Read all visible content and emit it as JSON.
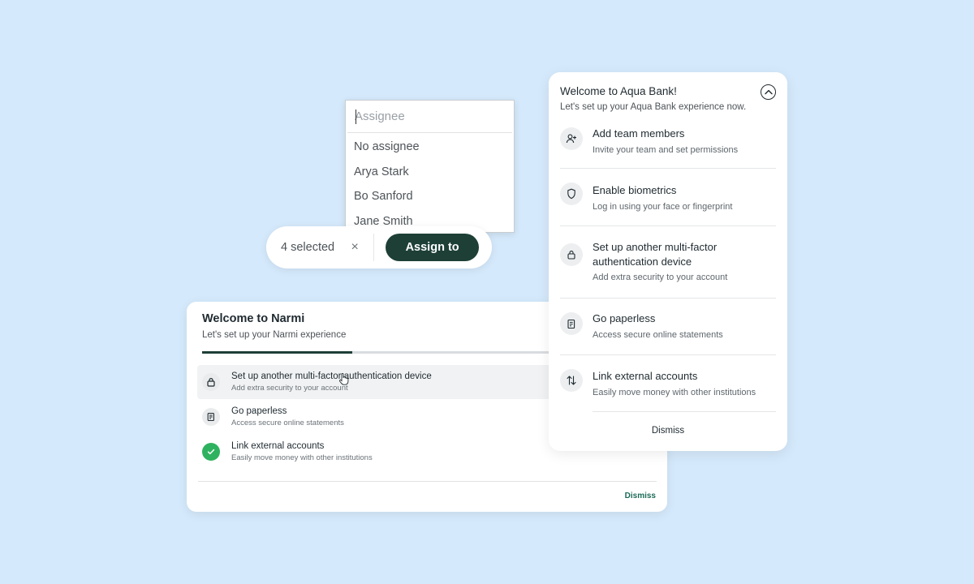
{
  "assignee_dropdown": {
    "placeholder": "Assignee",
    "options": [
      "No assignee",
      "Arya Stark",
      "Bo Sanford",
      "Jane Smith"
    ]
  },
  "selection_bar": {
    "count_text": "4 selected",
    "clear_symbol": "×",
    "assign_label": "Assign to"
  },
  "narmi_card": {
    "title": "Welcome to Narmi",
    "subtitle": "Let's set up your Narmi experience",
    "progress_fraction": 0.43,
    "items": [
      {
        "title": "Set up another multi-factor authentication device",
        "desc": "Add extra security to your account",
        "icon": "lock-icon",
        "done": false,
        "hovered": true
      },
      {
        "title": "Go paperless",
        "desc": "Access secure online statements",
        "icon": "document-icon",
        "done": false,
        "hovered": false
      },
      {
        "title": "Link external accounts",
        "desc": "Easily move money with other institutions",
        "icon": "check-icon",
        "done": true,
        "hovered": false
      }
    ],
    "dismiss_label": "Dismiss"
  },
  "aqua_panel": {
    "title": "Welcome to Aqua Bank!",
    "subtitle": "Let's set up your Aqua Bank experience now.",
    "items": [
      {
        "title": "Add team members",
        "desc": "Invite your team and set permissions",
        "icon": "add-user-icon"
      },
      {
        "title": "Enable biometrics",
        "desc": "Log in using your face or fingerprint",
        "icon": "shield-icon"
      },
      {
        "title": "Set up another multi-factor authentication device",
        "desc": "Add extra security to your account",
        "icon": "lock-icon"
      },
      {
        "title": "Go paperless",
        "desc": "Access secure online statements",
        "icon": "document-icon"
      },
      {
        "title": "Link external accounts",
        "desc": "Easily move money with other institutions",
        "icon": "transfer-icon"
      }
    ],
    "dismiss_label": "Dismiss"
  },
  "colors": {
    "background": "#d4e9fb",
    "primary_dark": "#1d3f36",
    "success": "#2fb25f",
    "link": "#1d6b58"
  }
}
